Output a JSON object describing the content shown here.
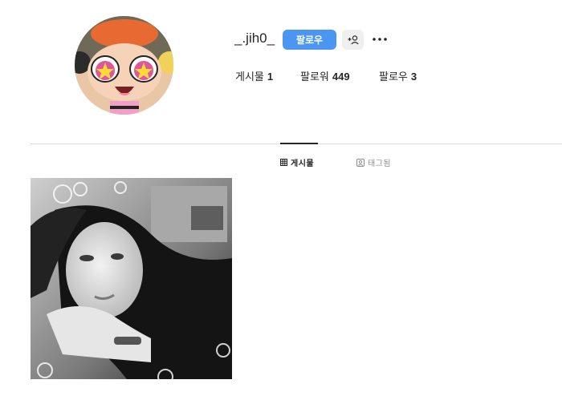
{
  "profile": {
    "username": "_.jih0_",
    "follow_label": "팔로우",
    "avatar_icon": "cartoon-avatar"
  },
  "stats": {
    "posts_label": "게시물",
    "posts_count": "1",
    "followers_label": "팔로워",
    "followers_count": "449",
    "following_label": "팔로우",
    "following_count": "3"
  },
  "tabs": [
    {
      "label": "게시물",
      "icon": "grid-icon",
      "active": true
    },
    {
      "label": "태그됨",
      "icon": "tag-person-icon",
      "active": false
    }
  ],
  "posts": [
    {
      "kind": "photo",
      "style": "black-and-white"
    }
  ],
  "colors": {
    "accent": "#4a96f0",
    "divider": "#dbdbdb",
    "secondary_button": "#efefef",
    "muted_text": "#8e8e8e"
  }
}
